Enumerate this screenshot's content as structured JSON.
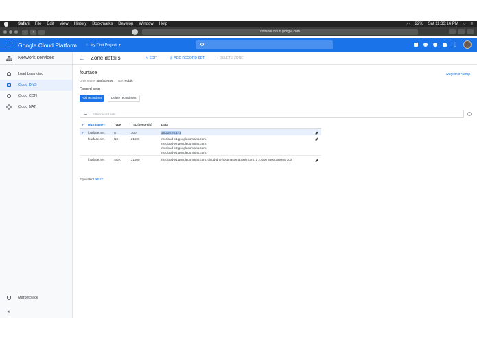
{
  "menubar": {
    "app": "Safari",
    "items": [
      "File",
      "Edit",
      "View",
      "History",
      "Bookmarks",
      "Develop",
      "Window",
      "Help"
    ],
    "battery": "22%",
    "clock": "Sat 11:33:16 PM"
  },
  "browser": {
    "url": "console.cloud.google.com"
  },
  "header": {
    "title": "Google Cloud Platform",
    "project": "My First Project",
    "project_chevron": "▾"
  },
  "sidebar": {
    "section_title": "Network services",
    "items": [
      {
        "label": "Load balancing",
        "icon": "load-balancing-icon"
      },
      {
        "label": "Cloud DNS",
        "icon": "dns-icon",
        "active": true
      },
      {
        "label": "Cloud CDN",
        "icon": "cdn-icon"
      },
      {
        "label": "Cloud NAT",
        "icon": "nat-icon"
      }
    ],
    "marketplace": "Marketplace",
    "collapse_glyph": "◂|"
  },
  "actionbar": {
    "title": "Zone details",
    "edit": "EDIT",
    "add_record_set": "ADD RECORD SET",
    "delete_zone": "DELETE ZONE"
  },
  "zone": {
    "name": "fourface",
    "dns_name_label": "DNS name:",
    "dns_name": "fourface.net.",
    "type_label": "Type:",
    "type": "Public",
    "registrar_link": "Registrar Setup"
  },
  "record_sets": {
    "heading": "Record sets",
    "add_button": "Add record set",
    "delete_button": "Delete record sets",
    "filter_placeholder": "Filter record sets",
    "columns": {
      "dns_name": "DNS name",
      "sort_glyph": "↑",
      "type": "Type",
      "ttl": "TTL (seconds)",
      "data": "Data"
    },
    "rows": [
      {
        "dns_name": "fourface.net.",
        "type": "A",
        "ttl": "300",
        "data": [
          "35.229.76.171"
        ],
        "checked": true
      },
      {
        "dns_name": "fourface.net.",
        "type": "NS",
        "ttl": "21600",
        "data": [
          "ns-cloud-e1.googledomains.com.",
          "ns-cloud-e2.googledomains.com.",
          "ns-cloud-e3.googledomains.com.",
          "ns-cloud-e4.googledomains.com."
        ]
      },
      {
        "dns_name": "fourface.net.",
        "type": "SOA",
        "ttl": "21600",
        "data": [
          "ns-cloud-e1.googledomains.com. cloud-dns-hostmaster.google.com. 1 21600 3600 259200 300"
        ]
      }
    ],
    "equivalent_label": "Equivalent",
    "equivalent_link": "REST"
  }
}
